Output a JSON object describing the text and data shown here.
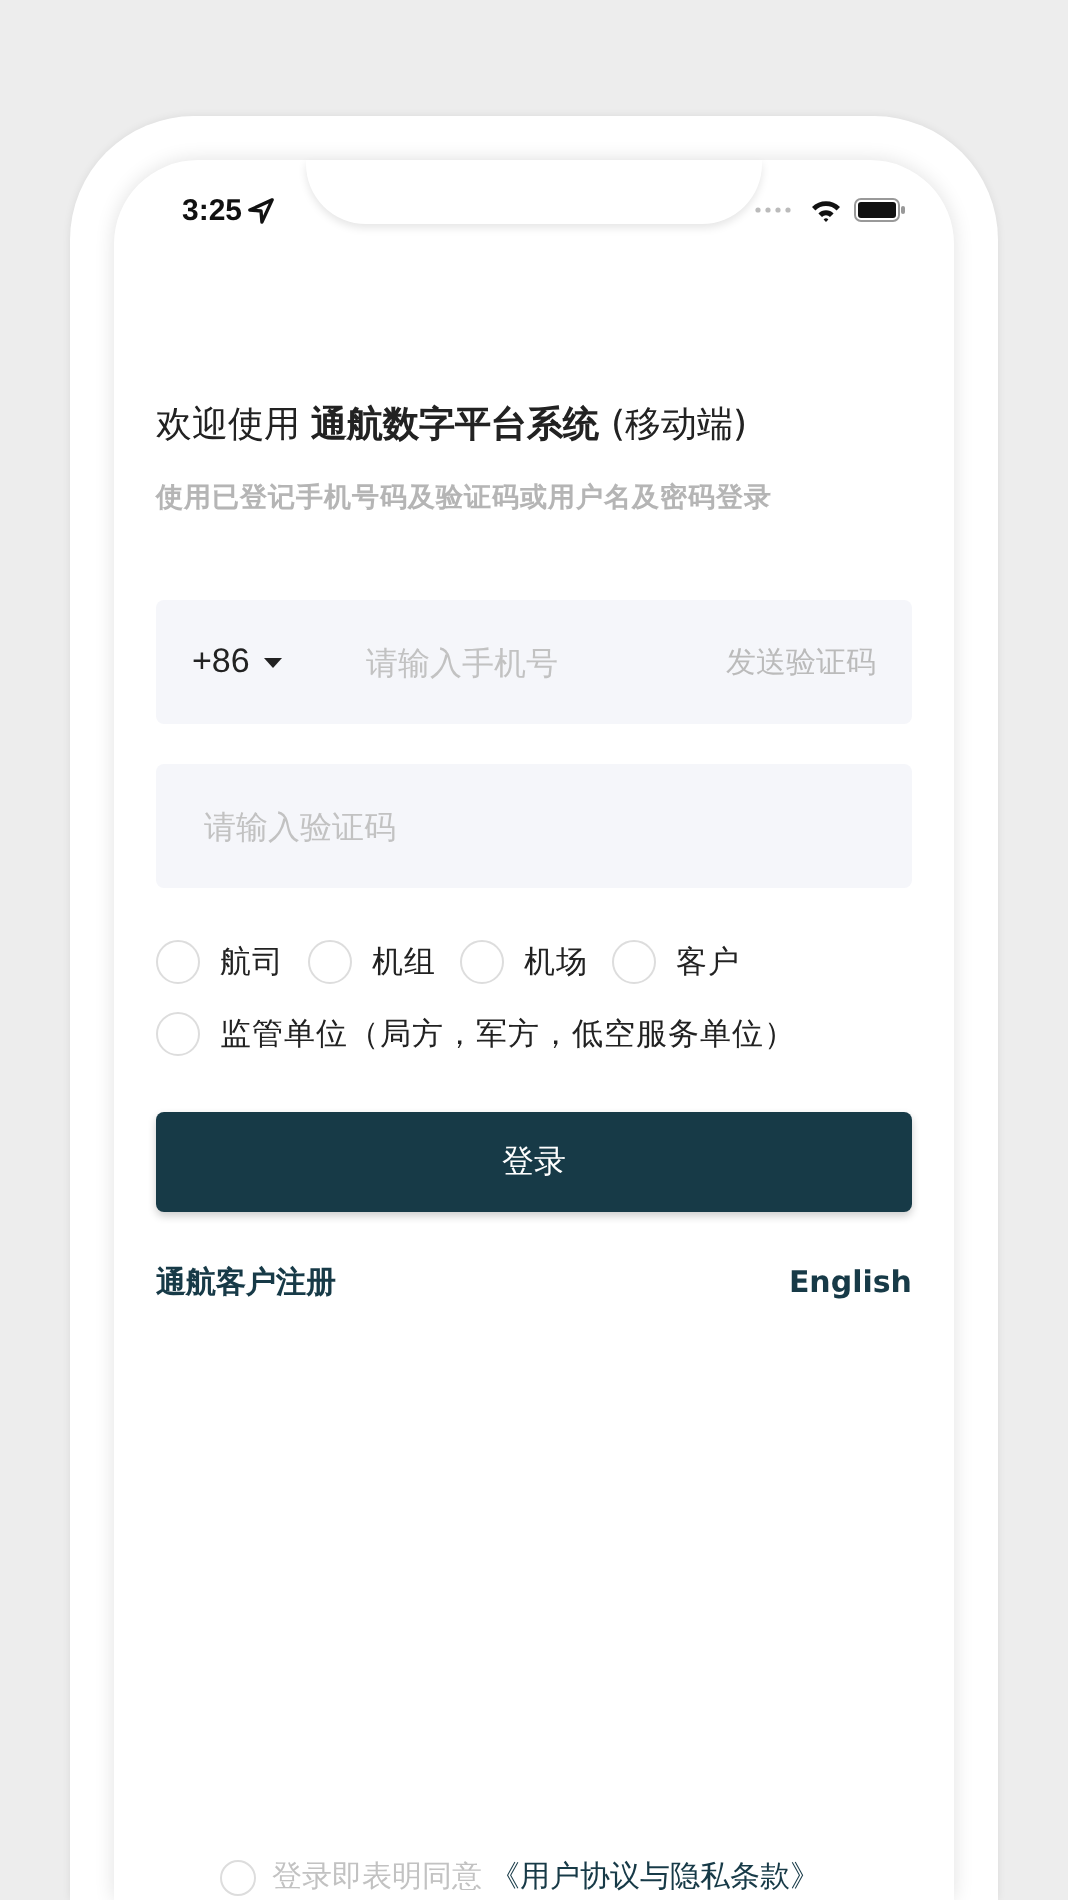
{
  "status_bar": {
    "time": "3:25"
  },
  "heading": "欢迎使用 **通航数字平台系统** (移动端)",
  "subtitle": "使用已登记手机号码及验证码或用户名及密码登录",
  "phone_field": {
    "country_code": "+86",
    "placeholder": "请输入手机号",
    "send_code": "发送验证码"
  },
  "code_field": {
    "placeholder": "请输入验证码"
  },
  "roles": [
    {
      "label": "航司",
      "selected": false
    },
    {
      "label": "机组",
      "selected": false
    },
    {
      "label": "机场",
      "selected": false
    },
    {
      "label": "客户",
      "selected": false
    },
    {
      "label": "监管单位（局方，军方，低空服务单位）",
      "selected": false
    }
  ],
  "login_button": "登录",
  "register_link": "通航客户注册",
  "language_link": "English",
  "agreement": {
    "text": "登录即表明同意",
    "link": "《用户协议与隐私条款》",
    "checked": false
  }
}
